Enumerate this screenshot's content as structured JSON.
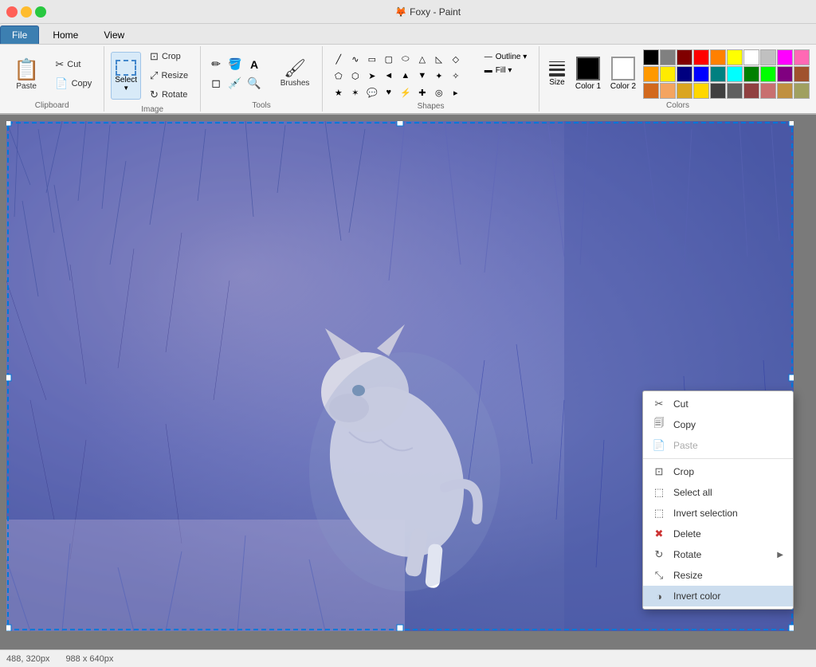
{
  "titlebar": {
    "title": "Foxy - Paint",
    "icon": "🦊"
  },
  "tabs": [
    {
      "label": "File",
      "active": true
    },
    {
      "label": "Home",
      "active": false
    },
    {
      "label": "View",
      "active": false
    }
  ],
  "ribbon": {
    "clipboard": {
      "paste_label": "Paste",
      "cut_label": "Cut",
      "copy_label": "Copy"
    },
    "image": {
      "crop_label": "Crop",
      "resize_label": "Resize",
      "rotate_label": "Rotate",
      "select_label": "Select",
      "label": "Image"
    },
    "tools": {
      "label": "Tools",
      "brushes_label": "Brushes"
    },
    "shapes": {
      "label": "Shapes",
      "outline_label": "Outline ▾",
      "fill_label": "Fill ▾"
    },
    "colors": {
      "label": "Colors",
      "size_label": "Size",
      "color1_label": "Color 1",
      "color2_label": "Color 2",
      "color1_value": "#000000",
      "color2_value": "#ffffff"
    }
  },
  "context_menu": {
    "items": [
      {
        "id": "cut",
        "label": "Cut",
        "icon": "✂",
        "disabled": false,
        "has_arrow": false
      },
      {
        "id": "copy",
        "label": "Copy",
        "icon": "📋",
        "disabled": false,
        "has_arrow": false
      },
      {
        "id": "paste",
        "label": "Paste",
        "icon": "📄",
        "disabled": true,
        "has_arrow": false
      },
      {
        "id": "sep1",
        "type": "separator"
      },
      {
        "id": "crop",
        "label": "Crop",
        "icon": "⊡",
        "disabled": false,
        "has_arrow": false
      },
      {
        "id": "select-all",
        "label": "Select all",
        "icon": "⬚",
        "disabled": false,
        "has_arrow": false
      },
      {
        "id": "invert-selection",
        "label": "Invert selection",
        "icon": "⬚",
        "disabled": false,
        "has_arrow": false
      },
      {
        "id": "delete",
        "label": "Delete",
        "icon": "✖",
        "disabled": false,
        "has_arrow": false
      },
      {
        "id": "rotate",
        "label": "Rotate",
        "icon": "↻",
        "disabled": false,
        "has_arrow": true
      },
      {
        "id": "resize",
        "label": "Resize",
        "icon": "⤡",
        "disabled": false,
        "has_arrow": false
      },
      {
        "id": "invert-color",
        "label": "Invert color",
        "icon": "◑",
        "disabled": false,
        "has_arrow": false,
        "active": true
      }
    ]
  },
  "palette_colors": [
    "#000000",
    "#808080",
    "#800000",
    "#ff0000",
    "#ff8000",
    "#ffff00",
    "#ffffff",
    "#c0c0c0",
    "#ff00ff",
    "#ff69b4",
    "#ff9900",
    "#ffeb00",
    "#000080",
    "#0000ff",
    "#008080",
    "#00ffff",
    "#008000",
    "#00ff00",
    "#800080",
    "#a0522d",
    "#d2691e",
    "#f4a460",
    "#daa520",
    "#ffd700",
    "#404040",
    "#606060",
    "#904040",
    "#c87070",
    "#c09040",
    "#a0a060"
  ],
  "statusbar": {
    "coords": "488, 320px",
    "size": "988 x 640px"
  }
}
